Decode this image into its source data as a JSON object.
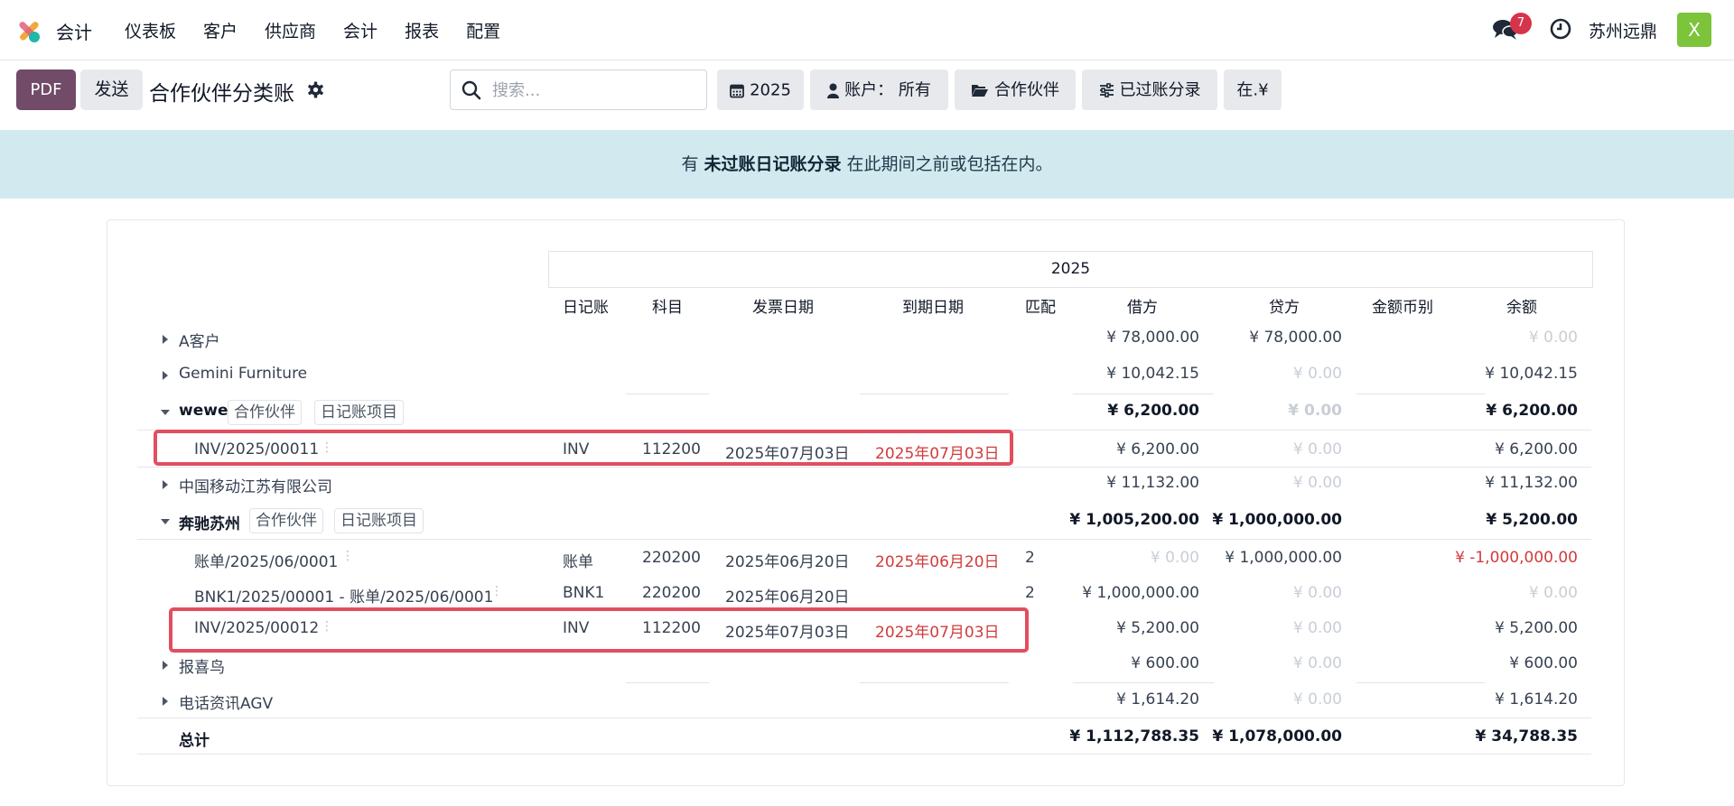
{
  "navbar": {
    "app_name": "会计",
    "menu": [
      "仪表板",
      "客户",
      "供应商",
      "会计",
      "报表",
      "配置"
    ],
    "chat_badge": "7",
    "company": "苏州远鼎",
    "avatar_letter": "X"
  },
  "control": {
    "pdf_label": "PDF",
    "send_label": "发送",
    "title": "合作伙伴分类账",
    "search_placeholder": "搜索...",
    "filters": {
      "period": "2025",
      "accounts": "账户： 所有",
      "partner": "合作伙伴",
      "posted": "已过账分录",
      "currency": "在.¥"
    }
  },
  "alert": {
    "prefix": "有 ",
    "link": "未过账日记账分录",
    "suffix": " 在此期间之前或包括在内。"
  },
  "report": {
    "period_header": "2025",
    "columns": {
      "journal": "日记账",
      "account": "科目",
      "invoice_date": "发票日期",
      "due_date": "到期日期",
      "matching": "匹配",
      "debit": "借方",
      "credit": "贷方",
      "currency": "金额币别",
      "balance": "余额"
    },
    "rows": [
      {
        "label": "A客户",
        "debit": "¥ 78,000.00",
        "credit": "¥ 78,000.00",
        "balance": "¥ 0.00"
      },
      {
        "label": "Gemini Furniture",
        "debit": "¥ 10,042.15",
        "credit": "¥ 0.00",
        "balance": "¥ 10,042.15"
      },
      {
        "label": "wewe",
        "tag1": "合作伙伴",
        "tag2": "日记账项目",
        "debit": "¥ 6,200.00",
        "credit": "¥ 0.00",
        "balance": "¥ 6,200.00"
      },
      {
        "label": "INV/2025/00011",
        "journal": "INV",
        "account": "112200",
        "invoice_date": "2025年07月03日",
        "due_date": "2025年07月03日",
        "debit": "¥ 6,200.00",
        "credit": "¥ 0.00",
        "balance": "¥ 6,200.00"
      },
      {
        "label": "中国移动江苏有限公司",
        "debit": "¥ 11,132.00",
        "credit": "¥ 0.00",
        "balance": "¥ 11,132.00"
      },
      {
        "label": "奔驰苏州",
        "tag1": "合作伙伴",
        "tag2": "日记账项目",
        "debit": "¥ 1,005,200.00",
        "credit": "¥ 1,000,000.00",
        "balance": "¥ 5,200.00"
      },
      {
        "label": "账单/2025/06/0001",
        "journal": "账单",
        "account": "220200",
        "invoice_date": "2025年06月20日",
        "due_date": "2025年06月20日",
        "matching": "2",
        "debit": "¥ 0.00",
        "credit": "¥ 1,000,000.00",
        "balance": "¥ -1,000,000.00"
      },
      {
        "label": "BNK1/2025/00001 - 账单/2025/06/0001",
        "journal": "BNK1",
        "account": "220200",
        "invoice_date": "2025年06月20日",
        "matching": "2",
        "debit": "¥ 1,000,000.00",
        "credit": "¥ 0.00",
        "balance": "¥ 0.00"
      },
      {
        "label": "INV/2025/00012",
        "journal": "INV",
        "account": "112200",
        "invoice_date": "2025年07月03日",
        "due_date": "2025年07月03日",
        "debit": "¥ 5,200.00",
        "credit": "¥ 0.00",
        "balance": "¥ 5,200.00"
      },
      {
        "label": "报喜鸟",
        "debit": "¥ 600.00",
        "credit": "¥ 0.00",
        "balance": "¥ 600.00"
      },
      {
        "label": "电话资讯AGV",
        "debit": "¥ 1,614.20",
        "credit": "¥ 0.00",
        "balance": "¥ 1,614.20"
      }
    ],
    "total": {
      "label": "总计",
      "debit": "¥ 1,112,788.35",
      "credit": "¥ 1,078,000.00",
      "balance": "¥ 34,788.35"
    }
  },
  "colors": {
    "brand": "#714b67",
    "alert_bg": "#d2e9ef",
    "highlight": "#e24e60",
    "overdue": "#d23b3b",
    "badge": "#d6344a",
    "avatar": "#7cc43a"
  }
}
